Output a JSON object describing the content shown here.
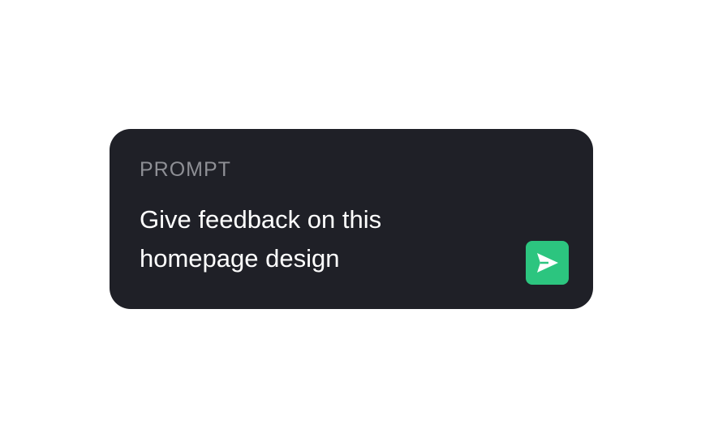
{
  "prompt": {
    "label": "PROMPT",
    "text": "Give feedback on this homepage design"
  },
  "send_button": {
    "icon": "send-icon",
    "color": "#2cc57f"
  },
  "colors": {
    "card_background": "#1f2027",
    "label": "#8e8f95",
    "text": "#ffffff",
    "page_background": "#ffffff"
  }
}
